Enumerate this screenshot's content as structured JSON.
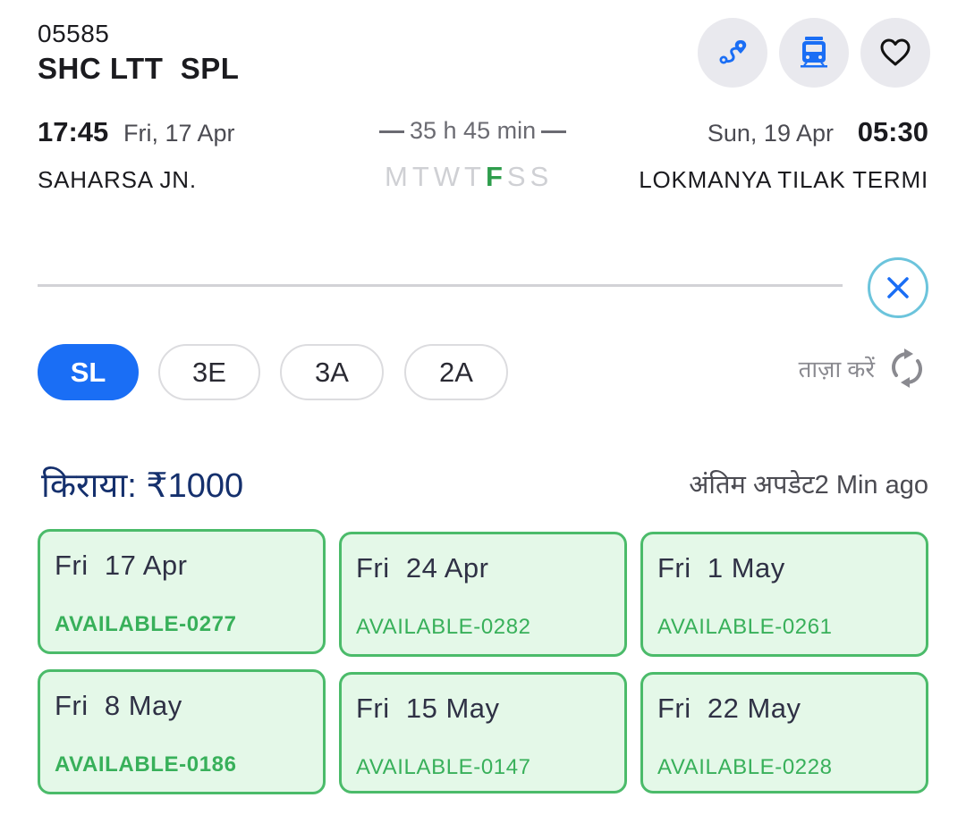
{
  "train": {
    "number": "05585",
    "name": "SHC LTT  SPL"
  },
  "header_icons": [
    "route-icon",
    "train-icon",
    "heart-icon"
  ],
  "journey": {
    "departure_time": "17:45",
    "departure_date": "Fri, 17 Apr",
    "departure_station": "SAHARSA JN.",
    "duration": "35 h 45 min",
    "arrival_date": "Sun, 19 Apr",
    "arrival_time": "05:30",
    "arrival_station": "LOKMANYA TILAK TERMI",
    "days": [
      {
        "label": "M",
        "active": false
      },
      {
        "label": "T",
        "active": false
      },
      {
        "label": "W",
        "active": false
      },
      {
        "label": "T",
        "active": false
      },
      {
        "label": "F",
        "active": true
      },
      {
        "label": "S",
        "active": false
      },
      {
        "label": "S",
        "active": false
      }
    ]
  },
  "classes": [
    {
      "label": "SL",
      "selected": true
    },
    {
      "label": "3E",
      "selected": false
    },
    {
      "label": "3A",
      "selected": false
    },
    {
      "label": "2A",
      "selected": false
    }
  ],
  "refresh_label": "ताज़ा करें",
  "fare": "किराया: ₹1000",
  "last_update": "अंतिम अपडेट2 Min ago",
  "availability": [
    {
      "date": "Fri  17 Apr",
      "status": "AVAILABLE-0277"
    },
    {
      "date": "Fri  24 Apr",
      "status": "AVAILABLE-0282"
    },
    {
      "date": "Fri  1 May",
      "status": "AVAILABLE-0261"
    },
    {
      "date": "Fri  8 May",
      "status": "AVAILABLE-0186"
    },
    {
      "date": "Fri  15 May",
      "status": "AVAILABLE-0147"
    },
    {
      "date": "Fri  22 May",
      "status": "AVAILABLE-0228"
    }
  ],
  "colors": {
    "accent": "#1a6ef5",
    "available_green": "#38b05a",
    "card_bg": "#e4f8e8",
    "fare_navy": "#15306d"
  }
}
